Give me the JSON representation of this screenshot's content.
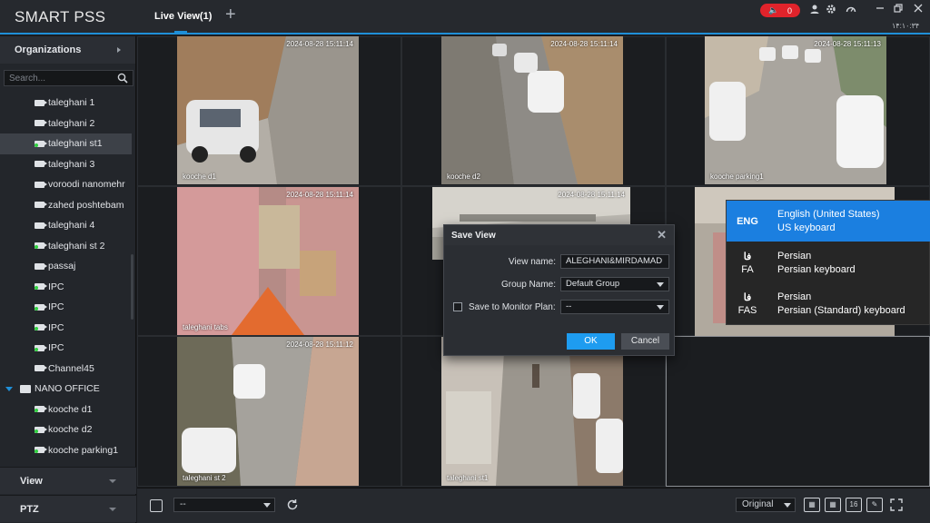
{
  "app": {
    "title": "SMART PSS",
    "active_tab": "Live View(1)",
    "add_tab": "+"
  },
  "topbar": {
    "alarm_count": "0",
    "clock": "۱۴:۱۰:۳۴",
    "colors": {
      "accent": "#1f8fd8",
      "alarm": "#e0232b"
    }
  },
  "sidebar": {
    "organizations_label": "Organizations",
    "search_placeholder": "Search...",
    "items": [
      {
        "label": "taleghani 1",
        "online": false,
        "selected": false
      },
      {
        "label": "taleghani 2",
        "online": false,
        "selected": false
      },
      {
        "label": "taleghani st1",
        "online": true,
        "selected": true
      },
      {
        "label": "taleghani 3",
        "online": false,
        "selected": false
      },
      {
        "label": "voroodi nanomehr",
        "online": false,
        "selected": false
      },
      {
        "label": "zahed poshtebam",
        "online": false,
        "selected": false
      },
      {
        "label": "taleghani 4",
        "online": false,
        "selected": false
      },
      {
        "label": "taleghani st 2",
        "online": true,
        "selected": false
      },
      {
        "label": "passaj",
        "online": false,
        "selected": false
      },
      {
        "label": "IPC",
        "online": true,
        "selected": false
      },
      {
        "label": "IPC",
        "online": true,
        "selected": false
      },
      {
        "label": "IPC",
        "online": true,
        "selected": false
      },
      {
        "label": "IPC",
        "online": true,
        "selected": false
      },
      {
        "label": "Channel45",
        "online": false,
        "selected": false
      }
    ],
    "group": {
      "label": "NANO OFFICE",
      "items": [
        {
          "label": "kooche d1",
          "online": true
        },
        {
          "label": "kooche d2",
          "online": true
        },
        {
          "label": "kooche parking1",
          "online": true
        }
      ]
    },
    "view_label": "View",
    "ptz_label": "PTZ"
  },
  "feeds": [
    {
      "timestamp": "2024-08-28 15:11:14",
      "camera": "kooche d1",
      "scene": "alley-wall"
    },
    {
      "timestamp": "2024-08-28 15:11:14",
      "camera": "kooche d2",
      "scene": "alley-cars"
    },
    {
      "timestamp": "2024-08-28 15:11:13",
      "camera": "kooche parking1",
      "scene": "parking"
    },
    {
      "timestamp": "2024-08-28 15:11:14",
      "camera": "taleghani tabs",
      "scene": "shop"
    },
    {
      "timestamp": "2024-08-28 15:11:14",
      "camera": "",
      "scene": "ceiling"
    },
    {
      "timestamp": "",
      "camera": "",
      "scene": "street"
    },
    {
      "timestamp": "2024-08-28 15:11:12",
      "camera": "taleghani st 2",
      "scene": "street-trees"
    },
    {
      "timestamp": "",
      "camera": "taleghani st1",
      "scene": "sidewalk"
    }
  ],
  "dialog": {
    "title": "Save View",
    "view_name_label": "View name:",
    "view_name_value": "ALEGHANI&MIRDAMAD",
    "group_name_label": "Group Name:",
    "group_name_value": "Default Group",
    "monitor_plan_label": "Save to Monitor Plan:",
    "monitor_plan_value": "--",
    "ok_label": "OK",
    "cancel_label": "Cancel"
  },
  "language_popup": [
    {
      "code": "ENG",
      "code2": "",
      "name": "English (United States)",
      "keyboard": "US keyboard",
      "active": true
    },
    {
      "code": "فا",
      "code2": "FA",
      "name": "Persian",
      "keyboard": "Persian keyboard",
      "active": false
    },
    {
      "code": "فا",
      "code2": "FAS",
      "name": "Persian",
      "keyboard": "Persian (Standard) keyboard",
      "active": false
    }
  ],
  "bottombar": {
    "view_select_value": "--",
    "stream_quality": "Original",
    "layout_16_label": "16"
  }
}
